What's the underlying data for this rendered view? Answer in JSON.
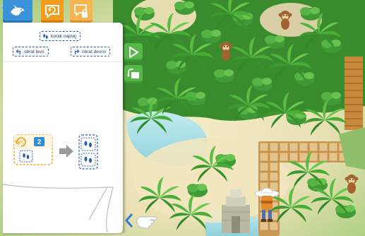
{
  "palette": {
    "forward_label": "korak naprej",
    "left_label": "obrat levo",
    "right_label": "obrat desno"
  },
  "hint": {
    "badge_number": "2"
  },
  "icons": {
    "tab_1": "bird-icon",
    "tab_2": "speech-loop-icon",
    "tab_3": "speech-lock-icon",
    "play": "play-icon",
    "reset": "reset-icon",
    "collapse": "chevron-left-icon",
    "block": "footprints-icon"
  },
  "colors": {
    "tab_blue": "#3a92d8",
    "tab_orange": "#f39c1d",
    "tab_orange_light": "#f7b451",
    "action_green": "#57b84a",
    "block_blue": "#2a5fb4",
    "hint_orange": "#f5a623",
    "jungle_green": "#3f9a36",
    "water": "#a7dde6",
    "sand": "#f2e6bf",
    "path_stone": "#d9b476"
  }
}
